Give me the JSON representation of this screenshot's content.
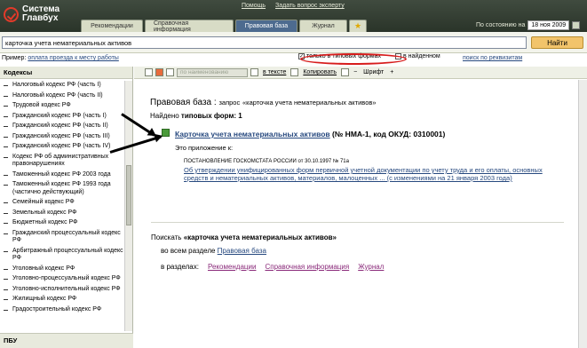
{
  "app": {
    "logo_line1": "Система",
    "logo_line2": "Главбух"
  },
  "top_links": {
    "help": "Помощь",
    "ask": "Задать вопрос эксперту"
  },
  "tabs": [
    {
      "label": "Рекомендации"
    },
    {
      "label": "Справочная информация"
    },
    {
      "label": "Правовая база"
    },
    {
      "label": "Журнал"
    }
  ],
  "status": {
    "label": "По состоянию на",
    "date": "18 ноя 2009"
  },
  "search": {
    "value": "карточка учета нематериальных активов",
    "button": "Найти"
  },
  "example": {
    "label": "Пример:",
    "link": "оплата проезда к месту работы"
  },
  "options": {
    "typical": "только в типовых формах",
    "found": "в найденном",
    "requisites": "поиск по реквизитам"
  },
  "left_panel": {
    "header": "Кодексы",
    "items": [
      "Налоговый кодекс РФ (часть I)",
      "Налоговый кодекс РФ (часть II)",
      "Трудовой кодекс РФ",
      "Гражданский кодекс РФ (часть I)",
      "Гражданский кодекс РФ (часть II)",
      "Гражданский кодекс РФ (часть III)",
      "Гражданский кодекс РФ (часть IV)",
      "Кодекс РФ об административных правонарушениях",
      "Таможенный кодекс РФ 2003 года",
      "Таможенный кодекс РФ 1993 года (частично действующий)",
      "Семейный кодекс РФ",
      "Земельный кодекс РФ",
      "Бюджетный кодекс РФ",
      "Гражданский процессуальный кодекс РФ",
      "Арбитражный процессуальный кодекс РФ",
      "Уголовный кодекс РФ",
      "Уголовно-процессуальный кодекс РФ",
      "Уголовно-исполнительный кодекс РФ",
      "Жилищный кодекс РФ",
      "Градостроительный кодекс РФ"
    ],
    "footer": "ПБУ"
  },
  "toolbar": {
    "select": "по наименованию",
    "in_text": "в тексте",
    "copy": "Копировать",
    "font": "Шрифт"
  },
  "content": {
    "base": "Правовая база :",
    "query_label": "запрос",
    "query": "«карточка учета нематериальных активов»",
    "found_label": "Найдено",
    "found_bold": "типовых форм:",
    "found_count": "1",
    "result_link": "Карточка учета нематериальных активов",
    "result_code": "(№ НМА-1, код ОКУД: 0310001)",
    "appendix": "Это приложение к:",
    "decree_label": "ПОСТАНОВЛЕНИЕ ГОСКОМСТАТА РОССИИ от 30.10.1997 № 71а",
    "decree_link": "Об утверждении унифицированных форм первичной учетной документации по учету труда и его оплаты, основных средств и нематериальных активов, материалов, малоценных ... (с изменениями на 21 января 2003 года)",
    "search_more": "Поискать",
    "search_more_query": "«карточка учета нематериальных активов»",
    "all_section_label": "во всем разделе",
    "all_section_link": "Правовая база",
    "sections_label": "в разделах:",
    "sections": [
      "Рекомендации",
      "Справочная информация",
      "Журнал"
    ]
  },
  "colors": {
    "topbar": "#323d31",
    "active_tab": "#4d6b8f",
    "link": "#27497f",
    "find_button": "#f2c46b",
    "highlight_oval": "#d71c1c"
  }
}
